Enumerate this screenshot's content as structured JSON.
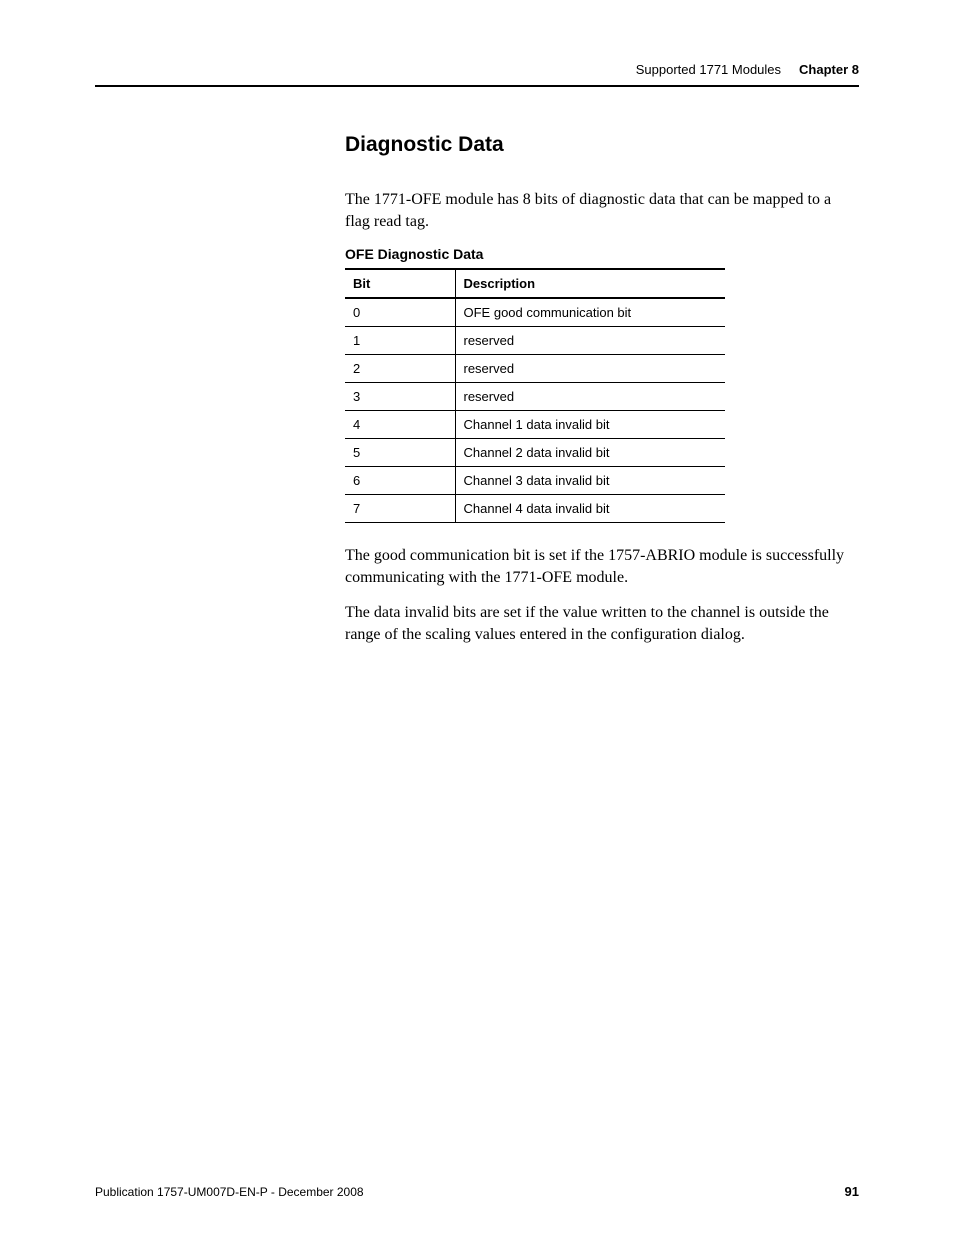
{
  "header": {
    "title": "Supported 1771 Modules",
    "chapter": "Chapter 8"
  },
  "section": {
    "heading": "Diagnostic Data",
    "intro": "The 1771-OFE module has 8 bits of diagnostic data that can be mapped to a flag read tag."
  },
  "table": {
    "caption": "OFE Diagnostic Data",
    "headers": {
      "bit": "Bit",
      "description": "Description"
    },
    "rows": [
      {
        "bit": "0",
        "description": "OFE good communication bit"
      },
      {
        "bit": "1",
        "description": "reserved"
      },
      {
        "bit": "2",
        "description": "reserved"
      },
      {
        "bit": "3",
        "description": "reserved"
      },
      {
        "bit": "4",
        "description": "Channel 1 data invalid bit"
      },
      {
        "bit": "5",
        "description": "Channel 2 data invalid bit"
      },
      {
        "bit": "6",
        "description": "Channel 3 data invalid bit"
      },
      {
        "bit": "7",
        "description": "Channel 4 data invalid bit"
      }
    ]
  },
  "paragraphs": {
    "p1": "The good communication bit is set if the 1757-ABRIO module is successfully communicating with the 1771-OFE module.",
    "p2": "The data invalid bits are set if the value written to the channel is outside the range of the scaling values entered in the configuration dialog."
  },
  "footer": {
    "publication": "Publication 1757-UM007D-EN-P - December 2008",
    "page": "91"
  }
}
